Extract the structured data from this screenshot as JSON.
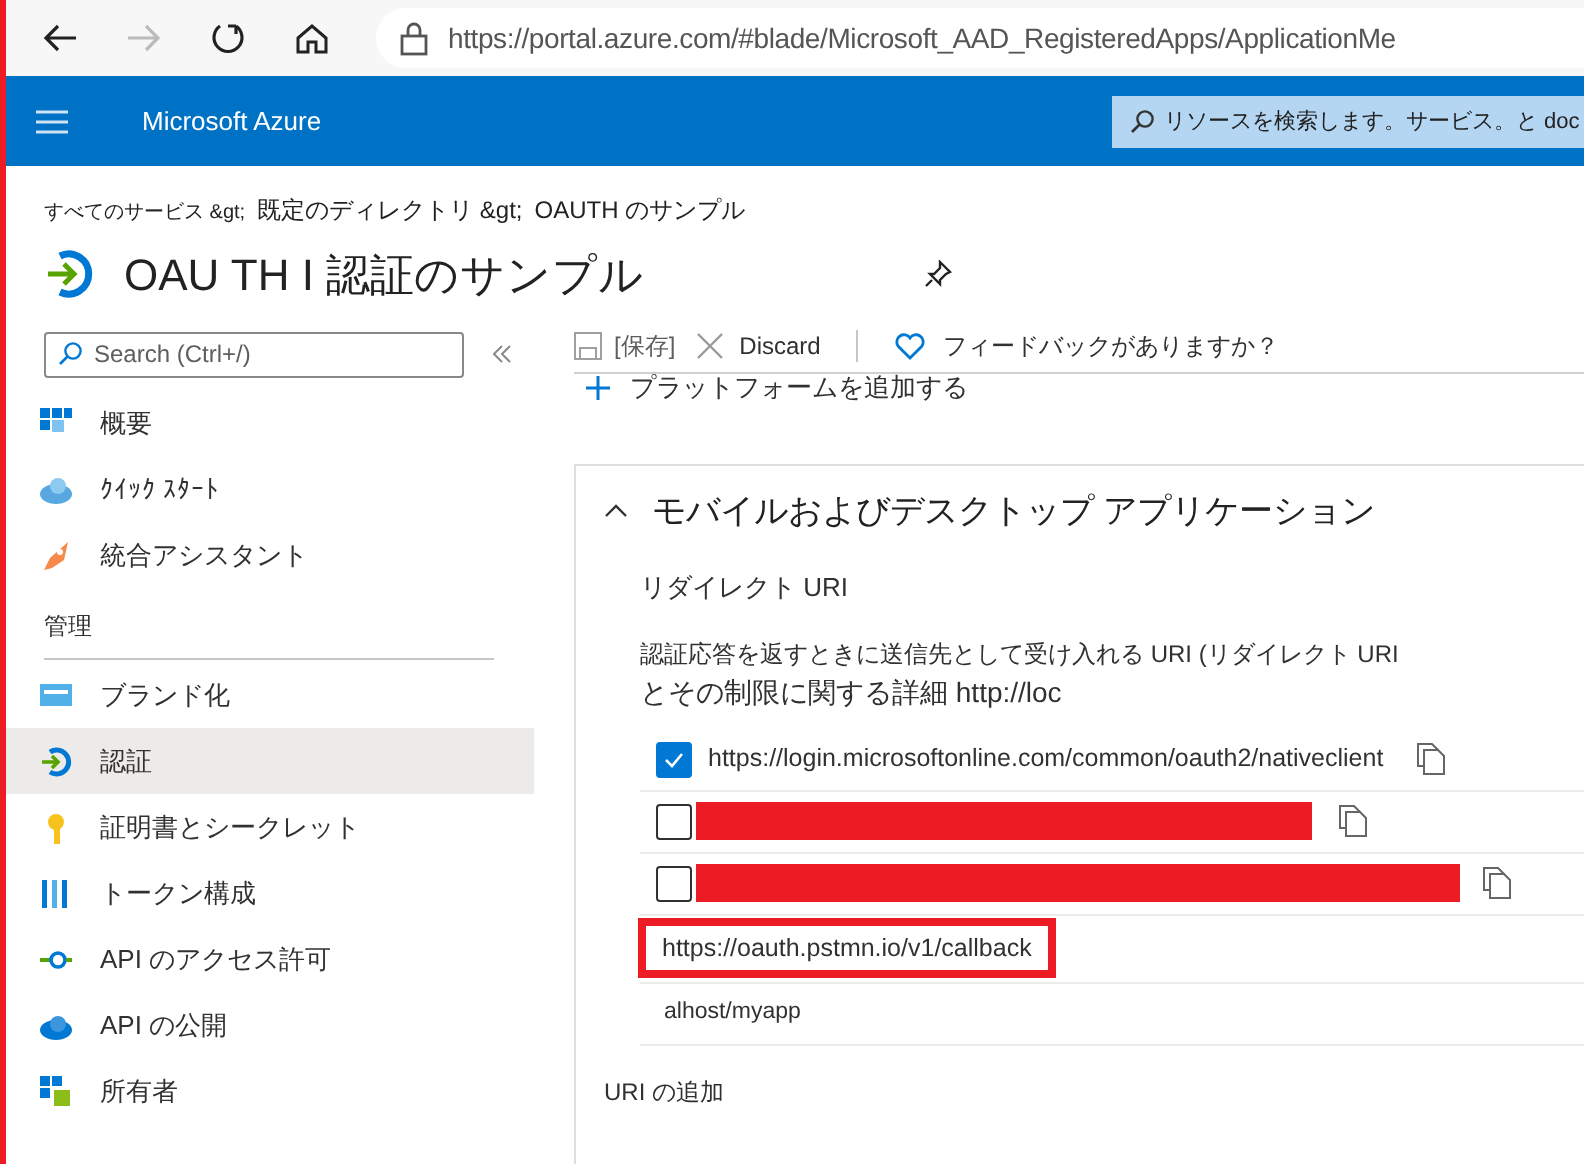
{
  "browser": {
    "url": "https://portal.azure.com/#blade/Microsoft_AAD_RegisteredApps/ApplicationMe"
  },
  "header": {
    "title": "Microsoft Azure",
    "search": {
      "placeholder": "リソースを検索します。サービス。と doc"
    }
  },
  "breadcrumb": [
    "すべてのサービス &gt;",
    "既定のディレクトリ &gt;",
    "OAUTH のサンプル"
  ],
  "page_title": "OAU TH I 認証のサンプル",
  "sidebar": {
    "search": {
      "placeholder": "Search (Ctrl+/)"
    },
    "items": [
      {
        "label": "概要",
        "selected": false
      },
      {
        "label": "ｸｲｯｸ ｽﾀｰﾄ",
        "selected": false
      },
      {
        "label": "統合アシスタント",
        "selected": false
      }
    ],
    "sections": [
      {
        "title": "管理",
        "items": [
          {
            "label": "ブランド化",
            "selected": false
          },
          {
            "label": "認証",
            "selected": true
          },
          {
            "label": "証明書とシークレット",
            "selected": false
          },
          {
            "label": "トークン構成",
            "selected": false
          },
          {
            "label": "API のアクセス許可",
            "selected": false
          },
          {
            "label": "API の公開",
            "selected": false
          },
          {
            "label": "所有者",
            "selected": false
          }
        ]
      }
    ]
  },
  "toolbar": {
    "save": "[保存]",
    "discard": "Discard",
    "feedback": "フィードバックがありますか？"
  },
  "add_platform": "プラットフォームを追加する",
  "panel": {
    "title": "モバイルおよびデスクトップ アプリケーション",
    "expanded": true,
    "section_label": "リダイレクト URI",
    "description": "認証応答を返すときに送信先として受け入れる URI (リダイレクト URI",
    "description_2": "とその制限に関する詳細 http://loc",
    "uris": [
      {
        "kind": "uri",
        "checked": true,
        "text": "https://login.microsoftonline.com/common/oauth2/nativeclient"
      },
      {
        "kind": "redacted",
        "checked": false
      },
      {
        "kind": "redacted",
        "checked": false
      },
      {
        "kind": "highlighted",
        "text": "https://oauth.pstmn.io/v1/callback"
      },
      {
        "kind": "plain",
        "text": "alhost/myapp"
      }
    ],
    "add_uri": "URI の追加"
  }
}
